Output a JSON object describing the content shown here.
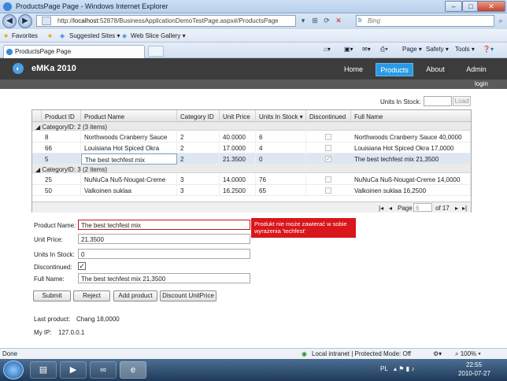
{
  "window": {
    "title": "ProductsPage Page - Windows Internet Explorer"
  },
  "address": {
    "url_prefix": "http://",
    "url_host": "localhost",
    "url_rest": ":52878/BusinessApplicationDemoTestPage.aspx#/ProductsPage"
  },
  "search": {
    "placeholder": "Bing"
  },
  "favorites": {
    "label": "Favorites",
    "suggested": "Suggested Sites ▾",
    "webslice": "Web Slice Gallery ▾"
  },
  "tab": {
    "title": "ProductsPage Page"
  },
  "commands": {
    "page": "Page ▾",
    "safety": "Safety ▾",
    "tools": "Tools ▾",
    "help": "❓▾"
  },
  "app": {
    "brand": "eMKa 2010",
    "nav": [
      "Home",
      "Products",
      "About",
      "Admin"
    ],
    "login": "login",
    "units_label": "Units In Stock:",
    "load_label": "Load"
  },
  "grid": {
    "columns": [
      "Product ID",
      "Product Name",
      "Category ID",
      "Unit Price",
      "Units In Stock ▾",
      "Discontinued",
      "Full Name"
    ],
    "group1": "CategoryID: 2 (3 items)",
    "group2": "CategoryID: 3 (2 items)",
    "rows": [
      {
        "id": "8",
        "name": "Northwoods Cranberry Sauce",
        "cat": "2",
        "price": "40.0000",
        "stock": "6",
        "disc": false,
        "full": "Northwoods Cranberry Sauce 40,0000"
      },
      {
        "id": "66",
        "name": "Louisiana Hot Spiced Okra",
        "cat": "2",
        "price": "17.0000",
        "stock": "4",
        "disc": false,
        "full": "Louisiana Hot Spiced Okra 17,0000"
      },
      {
        "id": "5",
        "name": "The best techfest mix",
        "cat": "2",
        "price": "21.3500",
        "stock": "0",
        "disc": true,
        "full": "The best techfest mix 21,3500"
      },
      {
        "id": "25",
        "name": "NuNuCa Nuß-Nougat-Creme",
        "cat": "3",
        "price": "14.0000",
        "stock": "76",
        "disc": false,
        "full": "NuNuCa Nuß-Nougat-Creme 14,0000"
      },
      {
        "id": "50",
        "name": "Valkoinen suklaa",
        "cat": "3",
        "price": "16.2500",
        "stock": "65",
        "disc": false,
        "full": "Valkoinen suklaa 16,2500"
      }
    ],
    "pager": {
      "first": "|◂",
      "prev": "◂",
      "page_label": "Page",
      "page_value": "6",
      "of": "of 17",
      "next": "▸",
      "last": "▸|"
    }
  },
  "form": {
    "product_name_label": "Product Name:",
    "product_name_value": "The best techfest mix",
    "error": "Produkt nie może zawierać w sobie wyrażenia 'techfest'",
    "unit_price_label": "Unit Price:",
    "unit_price_value": "21.3500",
    "units_label": "Units In Stock:",
    "units_value": "0",
    "discontinued_label": "Discontinued:",
    "discontinued_checked": true,
    "full_name_label": "Full Name:",
    "full_name_value": "The best techfest mix 21,3500",
    "buttons": [
      "Submit",
      "Reject",
      "Add product",
      "Discount UnitPrice"
    ]
  },
  "info": {
    "last_label": "Last product:",
    "last_value": "Chang 18,0000",
    "ip_label": "My IP:",
    "ip_value": "127.0.0.1"
  },
  "status": {
    "left": "Done",
    "zone": "Local intranet | Protected Mode: Off",
    "zoom": "⌕ 100% ▾"
  },
  "taskbar": {
    "lang": "PL",
    "time": "22:55",
    "date": "2010-07-27"
  },
  "colors": {
    "header": "#3c3c3c",
    "accent": "#2a9ae4",
    "error": "#d8161c"
  }
}
